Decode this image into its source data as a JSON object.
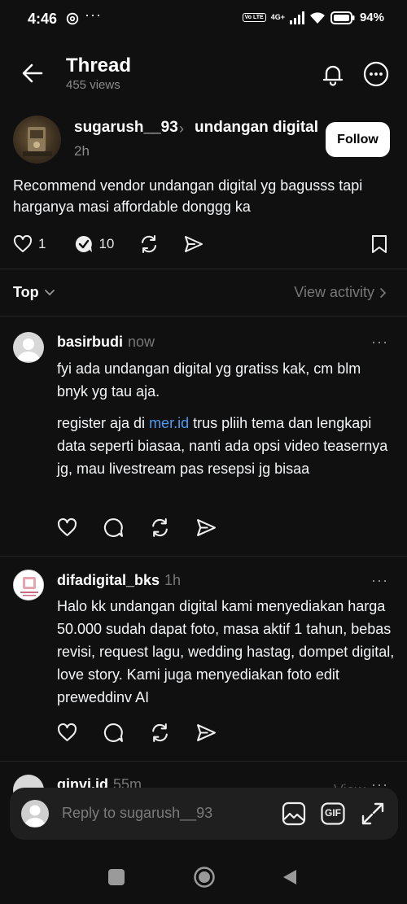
{
  "status_bar": {
    "time": "4:46",
    "dots": "···",
    "network": "4G+",
    "volte": "Vo LTE",
    "battery": "94%"
  },
  "header": {
    "title": "Thread",
    "views": "455 views"
  },
  "post": {
    "username": "sugarush__93",
    "separator": "›",
    "topic": "undangan digital",
    "time": "2h",
    "follow_label": "Follow",
    "body": "Recommend vendor undangan digital yg bagusss tapi harganya masi affordable donggg ka",
    "likes": "1",
    "replies": "10"
  },
  "sort": {
    "label": "Top",
    "view_activity": "View activity"
  },
  "replies": [
    {
      "username": "basirbudi",
      "time": "now",
      "more": "···",
      "paragraph1": "fyi ada undangan digital yg gratiss kak, cm blm bnyk yg tau aja.",
      "p2_before": "register aja di ",
      "p2_link": "mer.id",
      "p2_after": " trus pliih tema dan lengkapi data seperti biasaa, nanti ada opsi video teasernya jg, mau livestream pas resepsi jg bisaa"
    },
    {
      "username": "difadigital_bks",
      "time": "1h",
      "more": "···",
      "text": "Halo kk undangan digital kami menyediakan harga 50.000 sudah dapat foto, masa aktif 1 tahun, bebas revisi, request lagu, wedding hastag, dompet digital, love story. Kami juga menyediakan foto edit preweddinv AI",
      "avatar_text": "DIFA DIGITAL"
    },
    {
      "username": "qinvi.id",
      "time": "55m",
      "partial_right": "View",
      "more": "···"
    }
  ],
  "composer": {
    "placeholder": "Reply to sugarush__93",
    "gif_label": "GIF"
  },
  "colors": {
    "background": "#101010",
    "link": "#4c9bf7",
    "muted": "#777777"
  }
}
